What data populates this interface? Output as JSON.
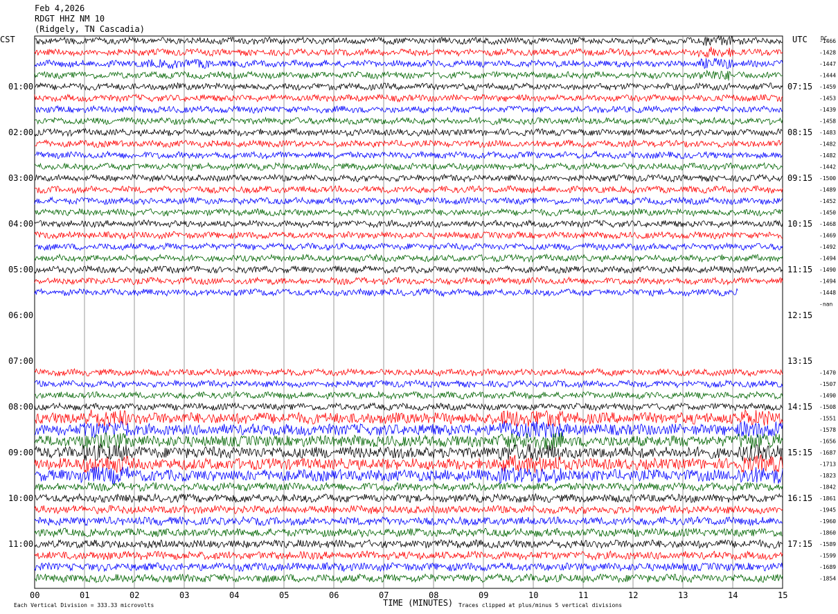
{
  "header": {
    "date": "Feb 4,2026",
    "station": "RDGT HHZ NM 10",
    "location": "(Ridgely, TN Cascadia)"
  },
  "chart_data": {
    "type": "line",
    "title": "Feb 4,2026",
    "left_timezone": "CST",
    "right_timezone": "UTC",
    "dc_header": "DC",
    "xlabel": "TIME (MINUTES)",
    "x_ticks": [
      "00",
      "01",
      "02",
      "03",
      "04",
      "05",
      "06",
      "07",
      "08",
      "09",
      "10",
      "11",
      "12",
      "13",
      "14",
      "15"
    ],
    "xlim": [
      0,
      15
    ],
    "minutes_per_line": 15,
    "left_hour_labels": [
      "01:00",
      "02:00",
      "03:00",
      "04:00",
      "05:00",
      "06:00",
      "07:00",
      "08:00",
      "09:00",
      "10:00",
      "11:00"
    ],
    "right_hour_labels": [
      "07:15",
      "08:15",
      "09:15",
      "10:15",
      "11:15",
      "12:15",
      "13:15",
      "14:15",
      "15:15",
      "16:15",
      "17:15"
    ],
    "trace_colors": [
      "#000000",
      "#ff0000",
      "#0000ff",
      "#006400"
    ],
    "dc_offsets": [
      "-1466",
      "-1428",
      "-1447",
      "-1444",
      "-1459",
      "-1453",
      "-1439",
      "-1458",
      "-1483",
      "-1482",
      "-1482",
      "-1442",
      "-1500",
      "-1489",
      "-1452",
      "-1450",
      "-1468",
      "-1469",
      "-1492",
      "-1494",
      "-1490",
      "-1494",
      "-1448",
      "-nan",
      "",
      "",
      "",
      "",
      "",
      "-1470",
      "-1507",
      "-1490",
      "-1508",
      "-1551",
      "-1578",
      "-1656",
      "-1687",
      "-1713",
      "-1823",
      "-1842",
      "-1861",
      "-1945",
      "-1960",
      "-1860",
      "-1589",
      "-1599",
      "-1689",
      "-1854"
    ],
    "data_gap": "05:45–06:45 CST (no data)",
    "footer_left": "Each Vertical Division =  333.33 microvolts",
    "footer_right": "Traces clipped at plus/minus 5 vertical divisions"
  }
}
